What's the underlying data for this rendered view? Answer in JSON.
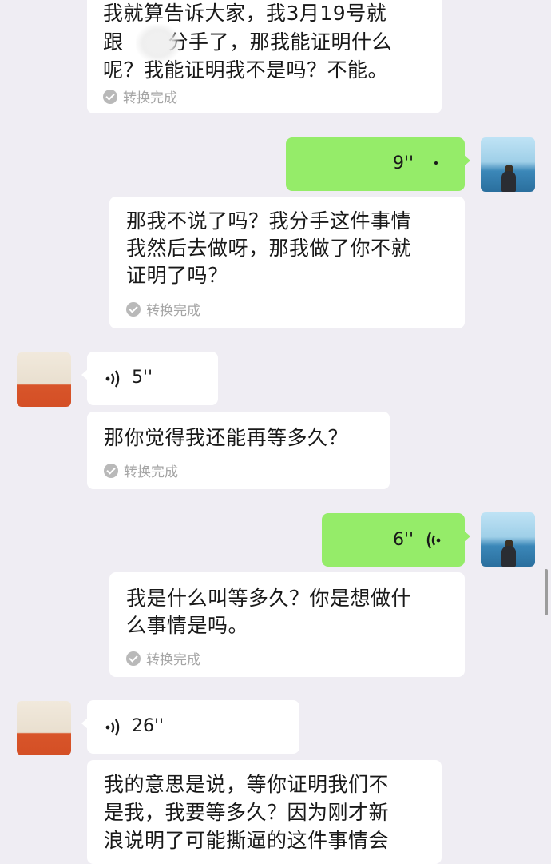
{
  "messages": {
    "m1": {
      "text_line1": "我就算告诉大家，我3月19号就",
      "text_line2_a": "跟",
      "text_line2_b": "分手了，那我能证明什么",
      "text_line3": "呢？我能证明我不是吗？不能。",
      "status": "转换完成"
    },
    "m2": {
      "duration": "9''",
      "text_line1": "那我不说了吗？我分手这件事情",
      "text_line2": "我然后去做呀，那我做了你不就",
      "text_line3": "证明了吗？",
      "status": "转换完成"
    },
    "m3": {
      "duration": "5''",
      "text_line1": "那你觉得我还能再等多久？",
      "status": "转换完成"
    },
    "m4": {
      "duration": "6''",
      "text_line1": "我是什么叫等多久？你是想做什",
      "text_line2": "么事情是吗。",
      "status": "转换完成"
    },
    "m5": {
      "duration": "26''",
      "text_line1": "我的意思是说，等你证明我们不",
      "text_line2": "是我，我要等多久？因为刚才新",
      "text_line3": "浪说明了可能撕逼的这件事情会"
    }
  },
  "icons": {
    "voice": "voice-wave-icon",
    "check": "check-circle-icon"
  },
  "colors": {
    "background": "#efedf3",
    "self_bubble": "#95ec69",
    "other_bubble": "#ffffff"
  }
}
